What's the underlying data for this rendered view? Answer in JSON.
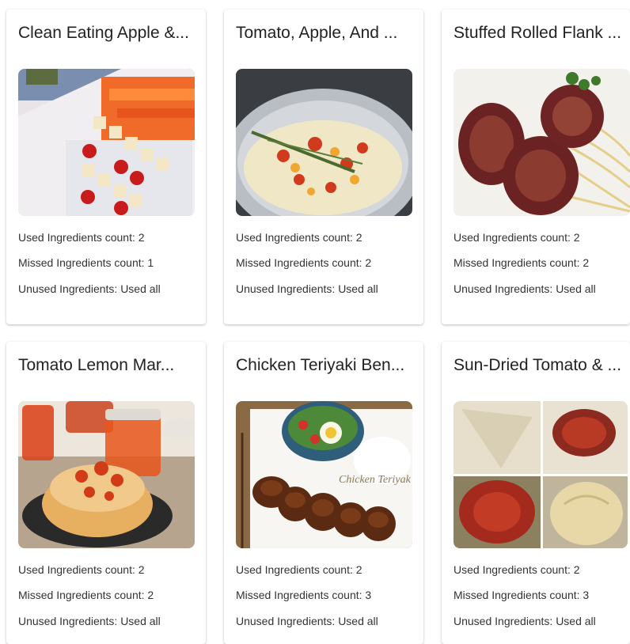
{
  "recipes": [
    {
      "title": "Clean Eating Apple &...",
      "image_alt": "skewers-image",
      "used_label": "Used Ingredients count: 2",
      "missed_label": "Missed Ingredients count: 1",
      "unused_label": "Unused Ingredients: Used all"
    },
    {
      "title": "Tomato, Apple, And ...",
      "image_alt": "pot-salad-image",
      "used_label": "Used Ingredients count: 2",
      "missed_label": "Missed Ingredients count: 2",
      "unused_label": "Unused Ingredients: Used all"
    },
    {
      "title": "Stuffed Rolled Flank ...",
      "image_alt": "flank-steak-image",
      "used_label": "Used Ingredients count: 2",
      "missed_label": "Missed Ingredients count: 2",
      "unused_label": "Unused Ingredients: Used all"
    },
    {
      "title": "Tomato Lemon Mar...",
      "image_alt": "marmalade-image",
      "used_label": "Used Ingredients count: 2",
      "missed_label": "Missed Ingredients count: 2",
      "unused_label": "Unused Ingredients: Used all"
    },
    {
      "title": "Chicken Teriyaki Ben...",
      "image_alt": "chicken-teriyaki-image",
      "image_caption": "Chicken Teriyak",
      "used_label": "Used Ingredients count: 2",
      "missed_label": "Missed Ingredients count: 3",
      "unused_label": "Unused Ingredients: Used all"
    },
    {
      "title": "Sun-Dried Tomato & ...",
      "image_alt": "sun-dried-tomato-bread-image",
      "used_label": "Used Ingredients count: 2",
      "missed_label": "Missed Ingredients count: 3",
      "unused_label": "Unused Ingredients: Used all"
    }
  ]
}
